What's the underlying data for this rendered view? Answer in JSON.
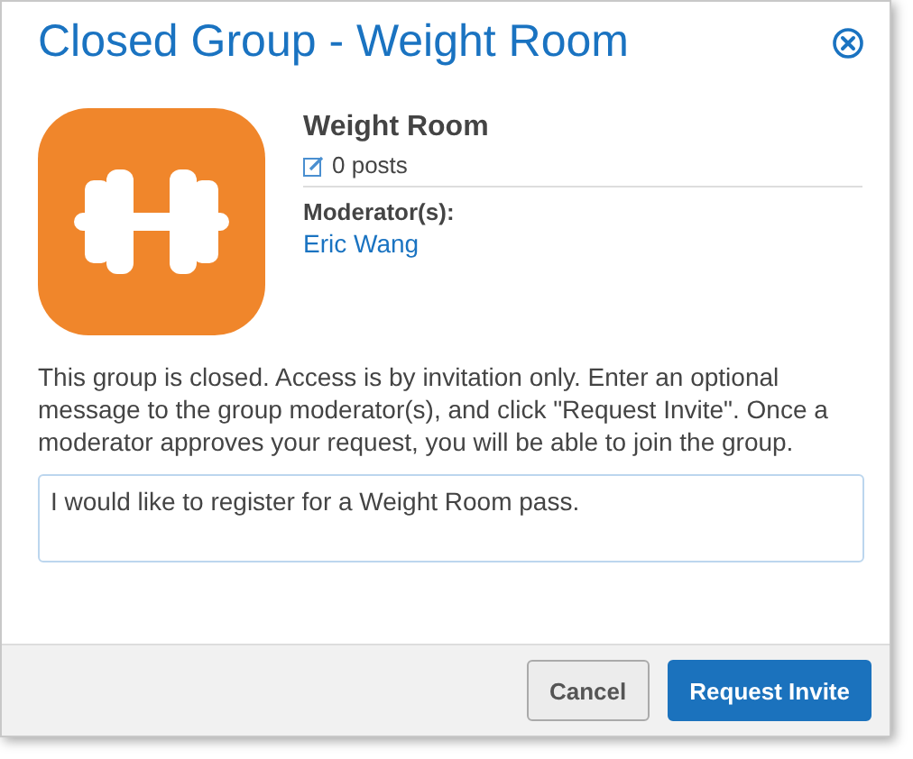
{
  "dialog": {
    "title": "Closed Group - Weight Room"
  },
  "group": {
    "name": "Weight Room",
    "posts": "0 posts",
    "moderators_label": "Moderator(s):",
    "moderators": [
      "Eric Wang"
    ]
  },
  "message": "This group is closed. Access is by invitation only. Enter an optional message to the group moderator(s), and click \"Request Invite\". Once a moderator approves your request, you will be able to join the group.",
  "request_field": {
    "value": "I would like to register for a Weight Room pass."
  },
  "buttons": [
    {
      "label": "Cancel",
      "kind": "secondary"
    },
    {
      "label": "Request Invite",
      "kind": "primary"
    }
  ]
}
